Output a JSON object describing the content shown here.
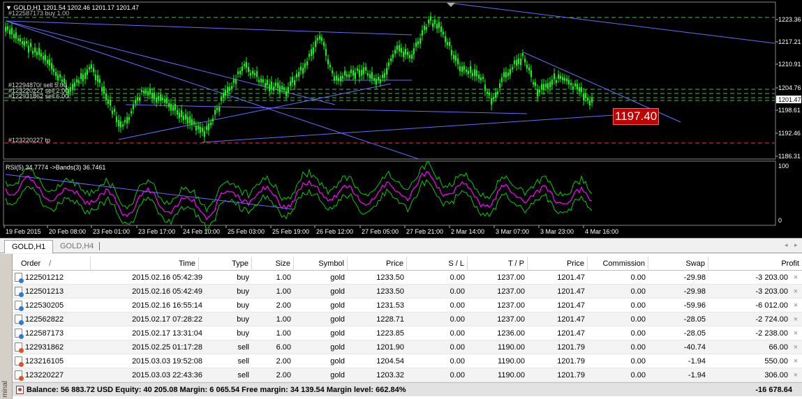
{
  "chart": {
    "header": "▼ GOLD,H1  1201.54 1202.46 1201.17 1201.47",
    "order_label_top": "#122587173 buy 1.00",
    "order_labels": [
      "#12294870/ sell 5.00",
      "#123220227 sell 2.00",
      "#122931862 sell 6.00"
    ],
    "tp_label": "#123220227 tp",
    "price_ticks": [
      "1223.36",
      "1217.21",
      "1210.91",
      "1204.76",
      "1201.47",
      "1198.61",
      "1192.46",
      "1186.31"
    ],
    "price_callout": "1197.40",
    "rsi_header": "RSI(5) 34.7774  ->Bands(3) 36.7461",
    "rsi_ticks": [
      "100",
      "0"
    ],
    "time_ticks": [
      "19 Feb 2015",
      "20 Feb 08:00",
      "23 Feb 01:00",
      "23 Feb 17:00",
      "24 Feb 10:00",
      "25 Feb 03:00",
      "25 Feb 19:00",
      "26 Feb 12:00",
      "27 Feb 05:00",
      "27 Feb 21:00",
      "2 Mar 14:00",
      "3 Mar 07:00",
      "3 Mar 23:00",
      "4 Mar 16:00"
    ],
    "colors": {
      "bg": "#000000",
      "candle": "#00ff00",
      "trend": "#6a6aff",
      "rsi": "#ff00ff",
      "bands": "#00cc00",
      "tp": "#ff3030",
      "callout": "#d01010"
    }
  },
  "tabs": [
    "GOLD,H1",
    "GOLD,H4"
  ],
  "nav": {
    "left": "◂",
    "right": "▸"
  },
  "terminal": {
    "side_label": "minal",
    "columns": [
      "Order",
      "/",
      "Time",
      "Type",
      "Size",
      "Symbol",
      "Price",
      "S / L",
      "T / P",
      "Price",
      "Commission",
      "Swap",
      "Profit"
    ],
    "rows": [
      {
        "order": "122501212",
        "time": "2015.02.16 05:42:39",
        "type": "buy",
        "size": "1.00",
        "symbol": "gold",
        "price": "1233.50",
        "sl": "0.00",
        "tp": "1237.00",
        "cur": "1201.47",
        "commission": "0.00",
        "swap": "-29.98",
        "profit": "-3 203.00"
      },
      {
        "order": "122501213",
        "time": "2015.02.16 05:42:49",
        "type": "buy",
        "size": "1.00",
        "symbol": "gold",
        "price": "1233.50",
        "sl": "0.00",
        "tp": "1237.00",
        "cur": "1201.47",
        "commission": "0.00",
        "swap": "-29.98",
        "profit": "-3 203.00"
      },
      {
        "order": "122530205",
        "time": "2015.02.16 16:55:14",
        "type": "buy",
        "size": "2.00",
        "symbol": "gold",
        "price": "1231.53",
        "sl": "0.00",
        "tp": "1237.00",
        "cur": "1201.47",
        "commission": "0.00",
        "swap": "-59.96",
        "profit": "-6 012.00"
      },
      {
        "order": "122562822",
        "time": "2015.02.17 07:28:22",
        "type": "buy",
        "size": "1.00",
        "symbol": "gold",
        "price": "1228.71",
        "sl": "0.00",
        "tp": "1237.00",
        "cur": "1201.47",
        "commission": "0.00",
        "swap": "-28.05",
        "profit": "-2 724.00"
      },
      {
        "order": "122587173",
        "time": "2015.02.17 13:31:04",
        "type": "buy",
        "size": "1.00",
        "symbol": "gold",
        "price": "1223.85",
        "sl": "0.00",
        "tp": "1236.00",
        "cur": "1201.47",
        "commission": "0.00",
        "swap": "-28.05",
        "profit": "-2 238.00"
      },
      {
        "order": "122931862",
        "time": "2015.02.25 01:17:28",
        "type": "sell",
        "size": "6.00",
        "symbol": "gold",
        "price": "1201.90",
        "sl": "0.00",
        "tp": "1190.00",
        "cur": "1201.79",
        "commission": "0.00",
        "swap": "-40.74",
        "profit": "66.00"
      },
      {
        "order": "123216105",
        "time": "2015.03.03 19:52:08",
        "type": "sell",
        "size": "2.00",
        "symbol": "gold",
        "price": "1204.54",
        "sl": "0.00",
        "tp": "1190.00",
        "cur": "1201.79",
        "commission": "0.00",
        "swap": "-1.94",
        "profit": "550.00"
      },
      {
        "order": "123220227",
        "time": "2015.03.03 22:43:36",
        "type": "sell",
        "size": "2.00",
        "symbol": "gold",
        "price": "1203.32",
        "sl": "0.00",
        "tp": "1190.00",
        "cur": "1201.79",
        "commission": "0.00",
        "swap": "-1.94",
        "profit": "306.00"
      }
    ],
    "close_glyph": "×",
    "summary": "Balance: 56 883.72 USD  Equity: 40 205.08  Margin: 6 065.54  Free margin: 34 139.54  Margin level: 662.84%",
    "total_profit": "-16 678.64"
  }
}
